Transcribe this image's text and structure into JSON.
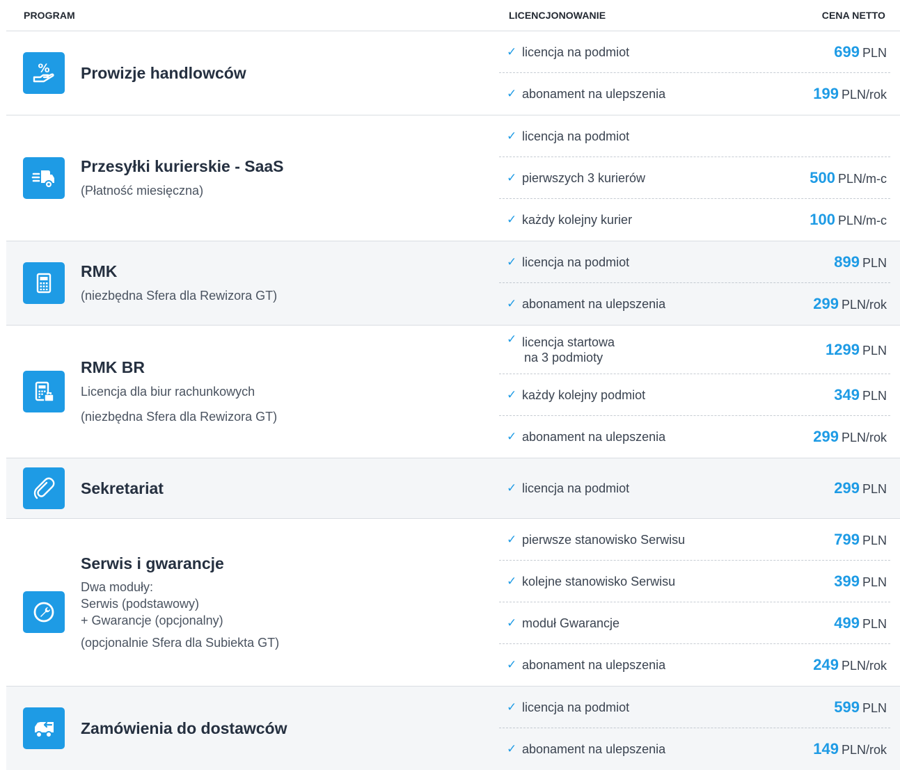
{
  "header": {
    "program": "PROGRAM",
    "licensing": "LICENCJONOWANIE",
    "price": "CENA NETTO"
  },
  "colors": {
    "accent": "#1e9be5",
    "shaded_row": "#f4f6f8"
  },
  "programs": [
    {
      "name": "Prowizje handlowców",
      "icon": "percent-hand-icon",
      "items": [
        {
          "label": "licencja na podmiot",
          "amount": "699",
          "unit": "PLN"
        },
        {
          "label": "abonament na ulepszenia",
          "amount": "199",
          "unit": "PLN/rok"
        }
      ]
    },
    {
      "name": "Przesyłki kurierskie - SaaS",
      "sub": "(Płatność miesięczna)",
      "icon": "delivery-truck-icon",
      "items": [
        {
          "label": "licencja na podmiot"
        },
        {
          "label": "pierwszych 3 kurierów",
          "amount": "500",
          "unit": "PLN/m-c"
        },
        {
          "label": "każdy kolejny kurier",
          "amount": "100",
          "unit": "PLN/m-c"
        }
      ]
    },
    {
      "name": "RMK",
      "sub": "(niezbędna Sfera dla Rewizora GT)",
      "icon": "calculator-icon",
      "items": [
        {
          "label": "licencja na podmiot",
          "amount": "899",
          "unit": "PLN"
        },
        {
          "label": "abonament na ulepszenia",
          "amount": "299",
          "unit": "PLN/rok"
        }
      ]
    },
    {
      "name": "RMK BR",
      "sub1": "Licencja dla biur rachunkowych",
      "sub2": "(niezbędna Sfera dla Rewizora GT)",
      "icon": "calculator-briefcase-icon",
      "items": [
        {
          "label": "licencja startowa",
          "label2": "na 3 podmioty",
          "amount": "1299",
          "unit": "PLN"
        },
        {
          "label": "każdy kolejny podmiot",
          "amount": "349",
          "unit": "PLN"
        },
        {
          "label": "abonament na ulepszenia",
          "amount": "299",
          "unit": "PLN/rok"
        }
      ]
    },
    {
      "name": "Sekretariat",
      "icon": "paperclip-icon",
      "items": [
        {
          "label": "licencja na podmiot",
          "amount": "299",
          "unit": "PLN"
        }
      ]
    },
    {
      "name": "Serwis i gwarancje",
      "sub1": "Dwa moduły:",
      "sub2": "Serwis (podstawowy)",
      "sub3": "+ Gwarancje (opcjonalny)",
      "sub4": "(opcjonalnie Sfera dla Subiekta GT)",
      "icon": "wrench-icon",
      "items": [
        {
          "label": "pierwsze stanowisko Serwisu",
          "amount": "799",
          "unit": "PLN"
        },
        {
          "label": "kolejne stanowisko Serwisu",
          "amount": "399",
          "unit": "PLN"
        },
        {
          "label": "moduł Gwarancje",
          "amount": "499",
          "unit": "PLN"
        },
        {
          "label": "abonament na ulepszenia",
          "amount": "249",
          "unit": "PLN/rok"
        }
      ]
    },
    {
      "name": "Zamówienia do dostawców",
      "icon": "truck-arrow-icon",
      "items": [
        {
          "label": "licencja na podmiot",
          "amount": "599",
          "unit": "PLN"
        },
        {
          "label": "abonament na ulepszenia",
          "amount": "149",
          "unit": "PLN/rok"
        }
      ]
    }
  ]
}
